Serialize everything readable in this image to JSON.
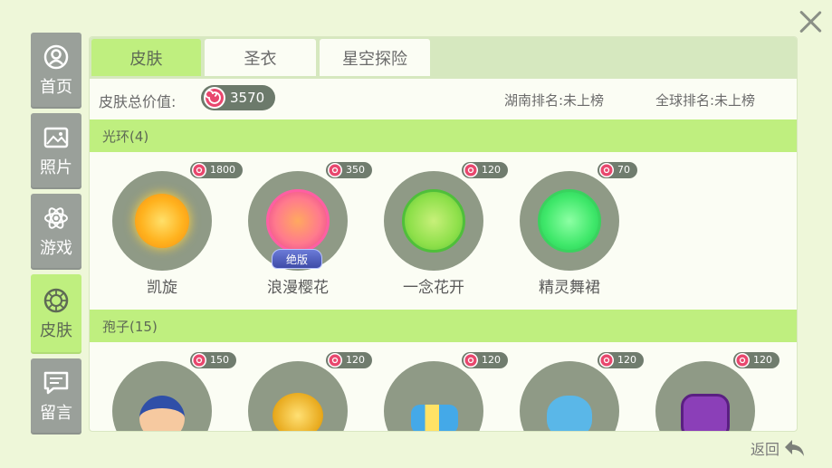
{
  "nav": {
    "items": [
      {
        "label": "首页",
        "icon": "user-circle-icon"
      },
      {
        "label": "照片",
        "icon": "image-icon"
      },
      {
        "label": "游戏",
        "icon": "atom-icon"
      },
      {
        "label": "皮肤",
        "icon": "skin-ring-icon",
        "active": true
      },
      {
        "label": "留言",
        "icon": "message-icon"
      }
    ]
  },
  "tabs": [
    {
      "label": "皮肤",
      "active": true
    },
    {
      "label": "圣衣"
    },
    {
      "label": "星空探险"
    }
  ],
  "summary": {
    "total_label": "皮肤总价值:",
    "total_value": "3570",
    "hunan_rank": "湖南排名:未上榜",
    "global_rank": "全球排名:未上榜"
  },
  "sections": [
    {
      "title": "光环(4)",
      "items": [
        {
          "name": "凯旋",
          "price": "1800"
        },
        {
          "name": "浪漫樱花",
          "price": "350",
          "badge": "绝版"
        },
        {
          "name": "一念花开",
          "price": "120"
        },
        {
          "name": "精灵舞裙",
          "price": "70"
        }
      ]
    },
    {
      "title": "孢子(15)",
      "items": [
        {
          "name": "",
          "price": "150"
        },
        {
          "name": "",
          "price": "120"
        },
        {
          "name": "",
          "price": "120"
        },
        {
          "name": "",
          "price": "120"
        },
        {
          "name": "",
          "price": "120"
        }
      ]
    }
  ],
  "back_label": "返回",
  "colors": {
    "accent": "#bfef7f",
    "nav_inactive": "#9aa09a",
    "circle": "#8f9a86",
    "price_pill": "#707c6e"
  }
}
